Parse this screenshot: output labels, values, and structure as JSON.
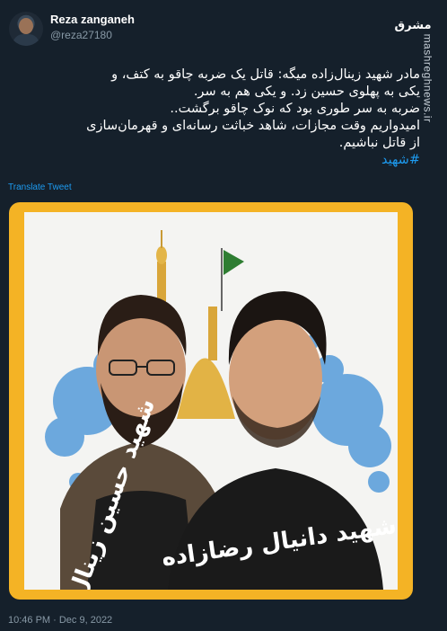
{
  "author": {
    "display_name": "Reza zanganeh",
    "handle": "@reza27180"
  },
  "watermark": {
    "logo_text": "مشرق",
    "site": "mashreghnews.ir"
  },
  "tweet": {
    "lines": [
      "مادر شهید زینال‌زاده میگه: قاتل یک ضربه چاقو به کتف، و",
      "یکی به پهلوی حسین زد. و یکی هم به سر.",
      "ضربه به سر طوری بود که نوک چاقو برگشت..",
      "امیدواریم وقت مجازات، شاهد خباثت رسانه‌ای و قهرمان‌سازی",
      "از قاتل نباشیم."
    ],
    "hashtag": "#شهید",
    "translate_label": "Translate Tweet",
    "timestamp": "10:46 PM · Dec 9, 2022"
  },
  "image": {
    "caption_left": "شهید حسین زینال زاده",
    "caption_right": "شهید دانیال رضازاده"
  },
  "colors": {
    "background": "#15202b",
    "link": "#1d9bf0",
    "frame": "#f4b325",
    "secondary_text": "#8899a6"
  }
}
